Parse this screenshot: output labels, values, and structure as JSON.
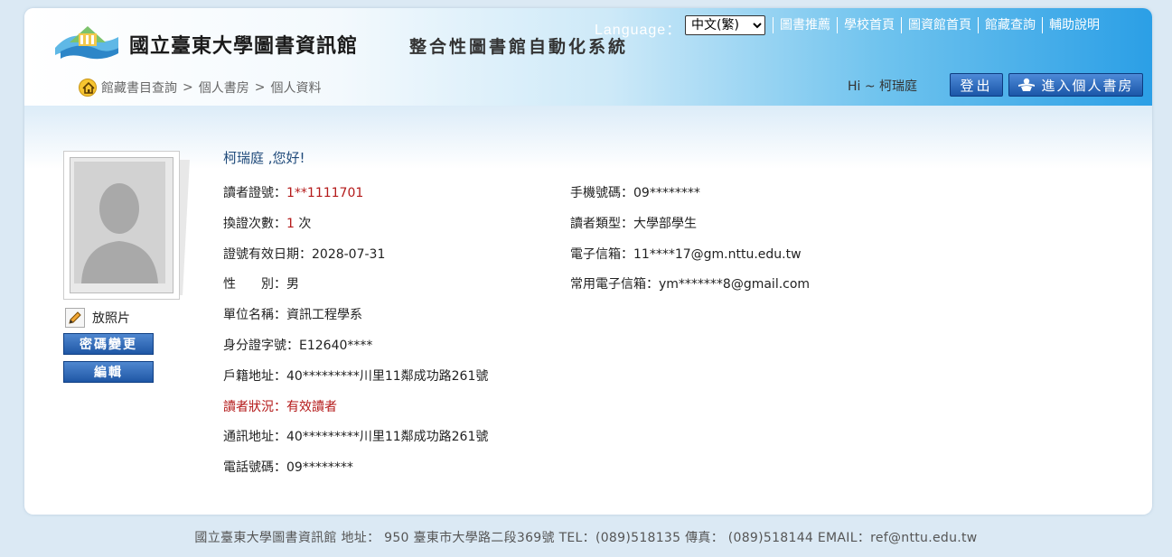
{
  "header": {
    "title": "國立臺東大學圖書資訊館",
    "subtitle": "整合性圖書館自動化系統",
    "language_label": "Language：",
    "language_selected": "中文(繁)",
    "links": [
      "圖書推薦",
      "學校首頁",
      "圖資館首頁",
      "館藏查詢",
      "輔助說明"
    ],
    "breadcrumb": [
      "館藏書目查詢",
      "個人書房",
      "個人資料"
    ],
    "breadcrumb_sep": ">",
    "greeting": "Hi ~ 柯瑞庭",
    "logout_label": "登出",
    "mylib_label": "進入個人書房"
  },
  "sidebar": {
    "upload_label": "放照片",
    "change_password_label": "密碼變更",
    "edit_label": "編輯"
  },
  "profile": {
    "hello": "柯瑞庭 ,您好!",
    "left": [
      {
        "label": "讀者證號：",
        "value": "1**1111701",
        "highlight": "value"
      },
      {
        "label": "換證次數：",
        "value": "1",
        "suffix": " 次",
        "highlight": "value"
      },
      {
        "label": "證號有效日期：",
        "value": "2028-07-31"
      },
      {
        "label": "性　　別：",
        "value": "男"
      },
      {
        "label": "單位名稱：",
        "value": "資訊工程學系"
      },
      {
        "label": "身分證字號：",
        "value": "E12640****"
      },
      {
        "label": "戶籍地址：",
        "value": "40*********川里11鄰成功路261號"
      },
      {
        "label": "讀者狀況：",
        "value": "有效讀者",
        "highlight": "all"
      },
      {
        "label": "通訊地址：",
        "value": "40*********川里11鄰成功路261號"
      },
      {
        "label": "電話號碼：",
        "value": "09********"
      }
    ],
    "right": [
      {
        "label": "手機號碼：",
        "value": "09********"
      },
      {
        "label": "讀者類型：",
        "value": "大學部學生"
      },
      {
        "label": "電子信箱：",
        "value": "11****17@gm.nttu.edu.tw"
      },
      {
        "label": "常用電子信箱：",
        "value": "ym*******8@gmail.com"
      }
    ]
  },
  "footer": {
    "text": "國立臺東大學圖書資訊館 地址： 950 臺東市大學路二段369號 TEL：(089)518135 傳真： (089)518144 EMAIL：ref@nttu.edu.tw"
  },
  "colors": {
    "accent_blue": "#1b56a8",
    "highlight_red": "#b41a1a",
    "page_bg": "#dbe9f4"
  }
}
